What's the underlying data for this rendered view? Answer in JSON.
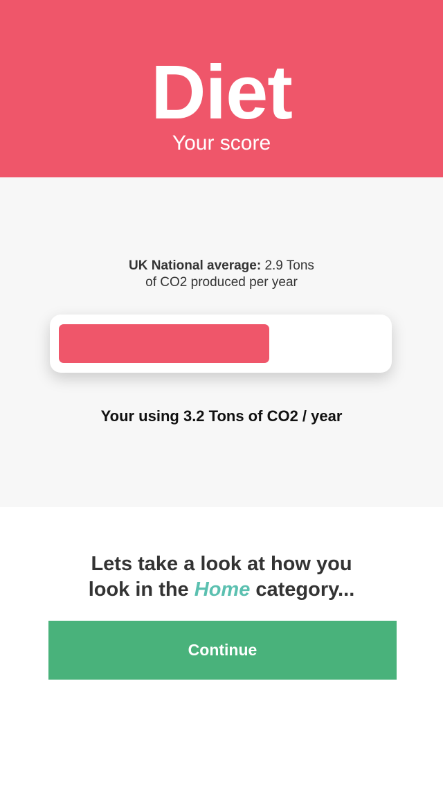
{
  "header": {
    "title": "Diet",
    "subtitle": "Your score"
  },
  "score": {
    "average_label": "UK National average:",
    "average_value_line1": "2.9 Tons",
    "average_value_line2": "of CO2 produced per year",
    "bar_fill_fraction": 0.65,
    "usage_text": "Your using 3.2 Tons of CO2 / year"
  },
  "next": {
    "prompt_line1": "Lets take a look at how you",
    "prompt_line2_before": "look in the",
    "category": "Home",
    "prompt_line2_after": "category..."
  },
  "continue_button": {
    "label": "Continue"
  },
  "colors": {
    "header": "#EF566A",
    "bar_fill": "#EF566A",
    "category": "#5BC0B0",
    "button": "#49B27B"
  }
}
